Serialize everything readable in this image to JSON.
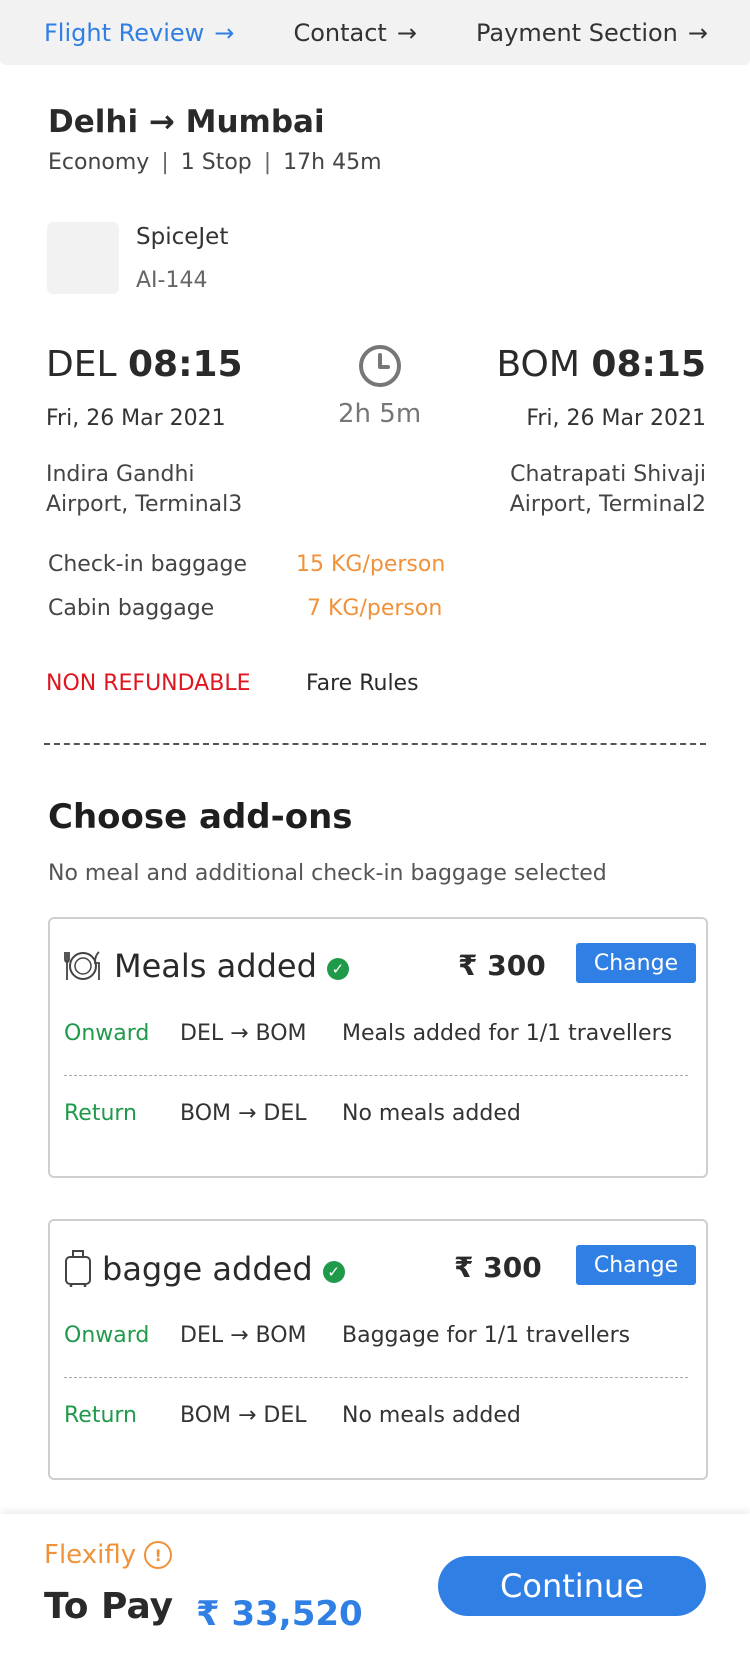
{
  "nav": {
    "steps": [
      {
        "label": "Flight Review",
        "arrow": "→"
      },
      {
        "label": "Contact",
        "arrow": "→"
      },
      {
        "label": "Payment Section",
        "arrow": "→"
      }
    ]
  },
  "flight": {
    "route": "Delhi → Mumbai",
    "class": "Economy",
    "stops": "1 Stop",
    "total_duration": "17h 45m",
    "airline": "SpiceJet",
    "flight_number": "AI-144",
    "departure": {
      "code": "DEL",
      "time": "08:15",
      "date": "Fri, 26 Mar 2021",
      "airport_line1": "Indira Gandhi",
      "airport_line2": "Airport, Terminal3"
    },
    "arrival": {
      "code": "BOM",
      "time": "08:15",
      "date": "Fri, 26 Mar 2021",
      "airport_line1": "Chatrapati Shivaji",
      "airport_line2": "Airport, Terminal2"
    },
    "duration": "2h 5m",
    "baggage": {
      "checkin_label": "Check-in baggage",
      "checkin_value": "15 KG/person",
      "cabin_label": "Cabin baggage",
      "cabin_value": "7 KG/person"
    },
    "refund_status": "NON REFUNDABLE",
    "fare_rules_label": "Fare Rules"
  },
  "addons": {
    "title": "Choose add-ons",
    "subtitle": "No meal and additional check-in baggage selected",
    "cards": [
      {
        "title": "Meals added",
        "price": "₹ 300",
        "change_label": "Change",
        "rows": [
          {
            "direction": "Onward",
            "segment": "DEL → BOM",
            "desc": "Meals added for 1/1 travellers"
          },
          {
            "direction": "Return",
            "segment": "BOM → DEL",
            "desc": "No meals added"
          }
        ]
      },
      {
        "title": "bagge added",
        "price": "₹ 300",
        "change_label": "Change",
        "rows": [
          {
            "direction": "Onward",
            "segment": "DEL → BOM",
            "desc": "Baggage  for 1/1 travellers"
          },
          {
            "direction": "Return",
            "segment": "BOM → DEL",
            "desc": "No meals added"
          }
        ]
      }
    ]
  },
  "footer": {
    "flexifly_label": "Flexifly",
    "to_pay_label": "To Pay",
    "amount": "₹ 33,520",
    "continue_label": "Continue"
  },
  "colors": {
    "accent": "#2f7fe4",
    "orange": "#f0923a",
    "green": "#1f9a4a",
    "red": "#e0161f"
  },
  "icons": {
    "nav_arrow": "arrow-right-icon",
    "clock": "clock-icon",
    "meal": "meal-icon",
    "luggage": "luggage-icon",
    "check": "check-circle-icon",
    "info": "info-icon"
  }
}
